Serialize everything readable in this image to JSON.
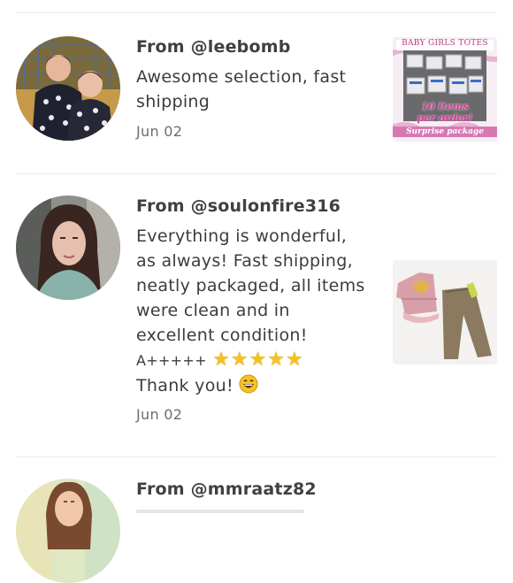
{
  "reviews": [
    {
      "from": "From @leebomb",
      "text": "Awesome selection, fast shipping",
      "date": "Jun 02",
      "thumb": {
        "title": "BABY GIRLS TOTES",
        "line1": "10 items",
        "line2": "per order!",
        "line3": "Surprise package"
      }
    },
    {
      "from": "From @soulonfire316",
      "text_lines": [
        "Everything is wonderful,",
        "as always! Fast shipping,",
        "neatly packaged, all items",
        "were clean and in",
        "excellent condition!",
        "A+++++",
        "Thank you!"
      ],
      "stars": "★★★★★",
      "emoji": "😊",
      "date": "Jun 02"
    },
    {
      "from": "From @mmraatz82"
    }
  ],
  "colors": {
    "star": "#f3c324",
    "emoji": "#f3c324",
    "divider": "#ececec",
    "thumb_banner": "#e8b3d3"
  },
  "icons": {
    "star": "star-icon",
    "emoji": "grinning-face-emoji"
  }
}
